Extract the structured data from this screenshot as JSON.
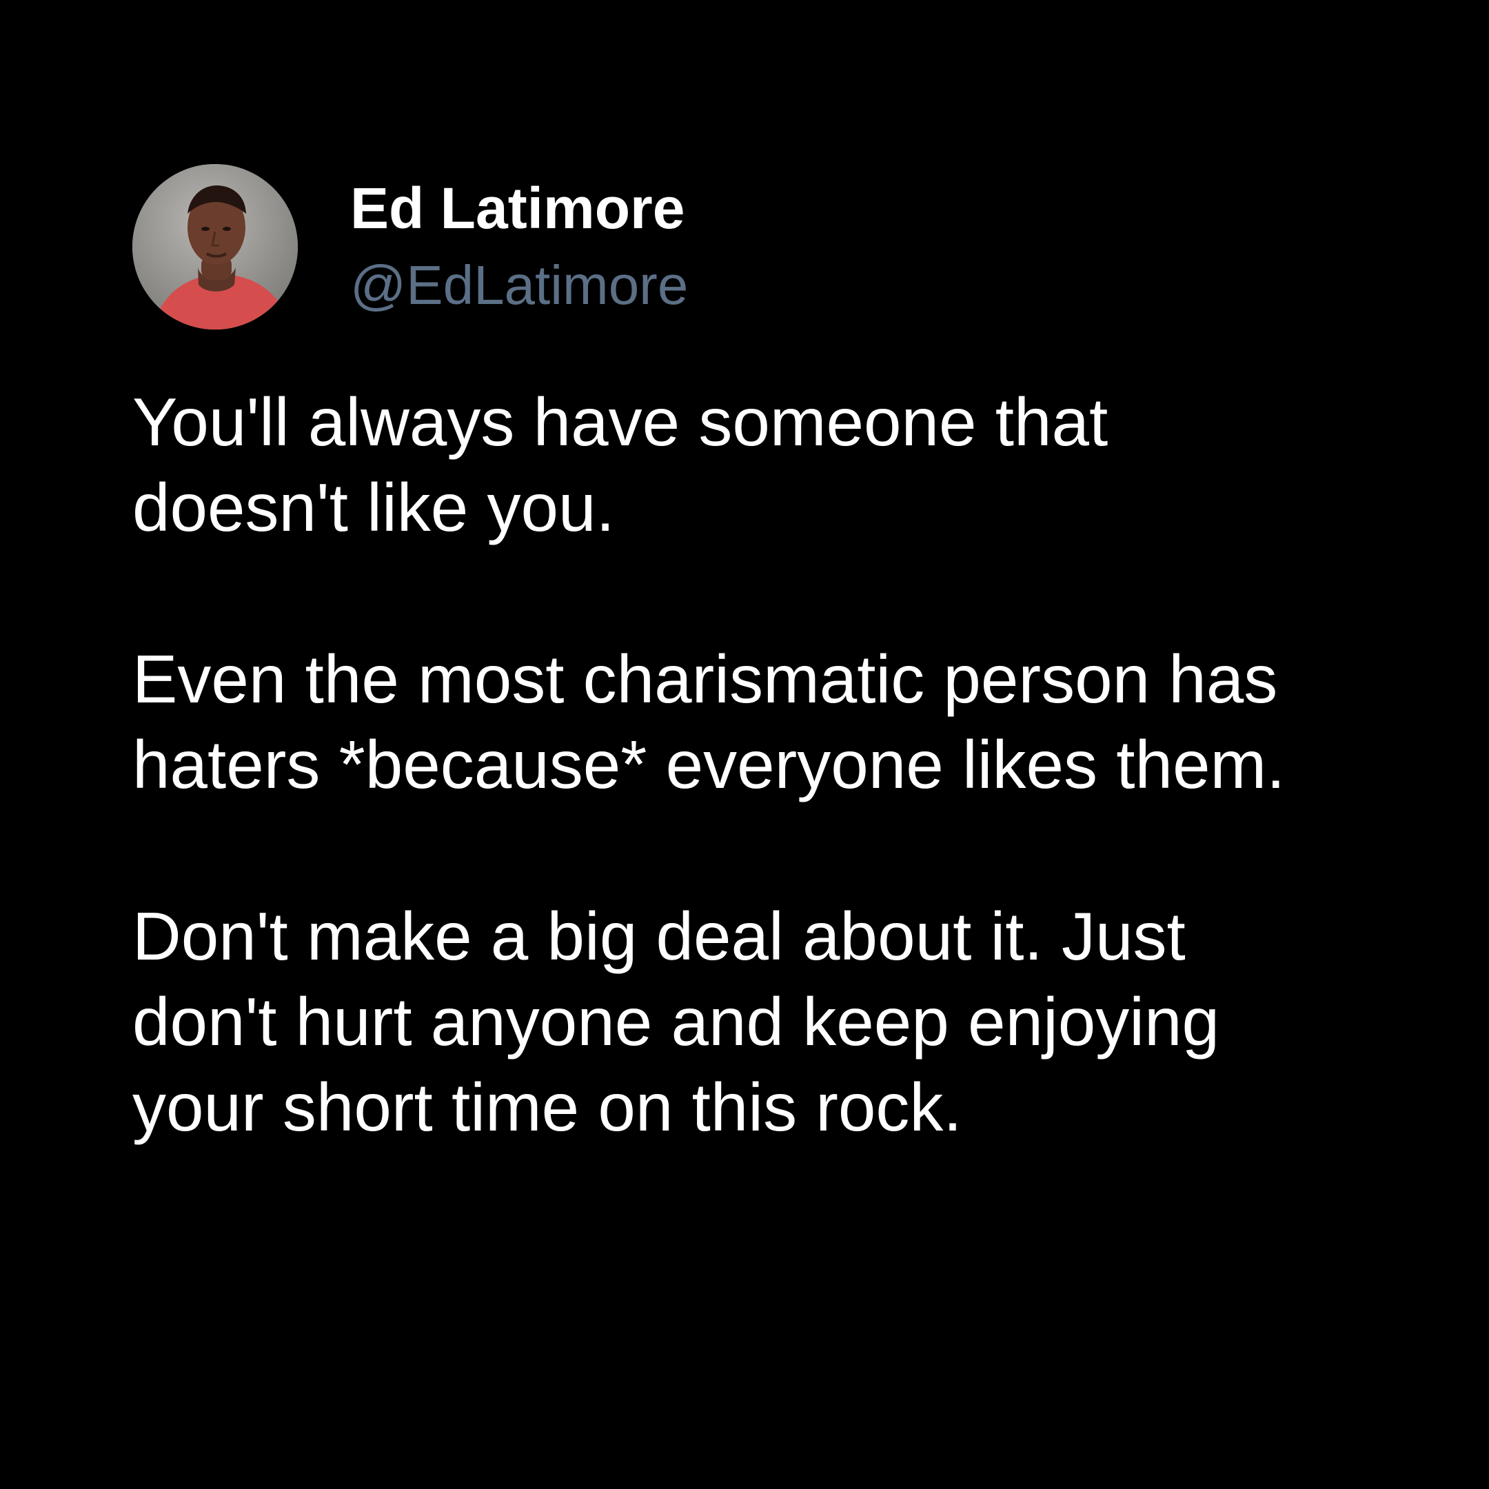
{
  "tweet": {
    "author": {
      "display_name": "Ed Latimore",
      "handle": "@EdLatimore",
      "avatar_icon": "profile-photo"
    },
    "paragraphs": [
      {
        "lines": [
          "You'll always have someone that",
          "doesn't like you."
        ]
      },
      {
        "lines": [
          "Even the most charismatic person has",
          "haters *because* everyone likes them."
        ]
      },
      {
        "lines": [
          "Don't make a big deal about it. Just",
          "don't hurt anyone and keep enjoying",
          "your short time on this rock."
        ]
      }
    ]
  },
  "colors": {
    "background": "#000000",
    "text_primary": "#ffffff",
    "text_secondary": "#5b6f86"
  }
}
